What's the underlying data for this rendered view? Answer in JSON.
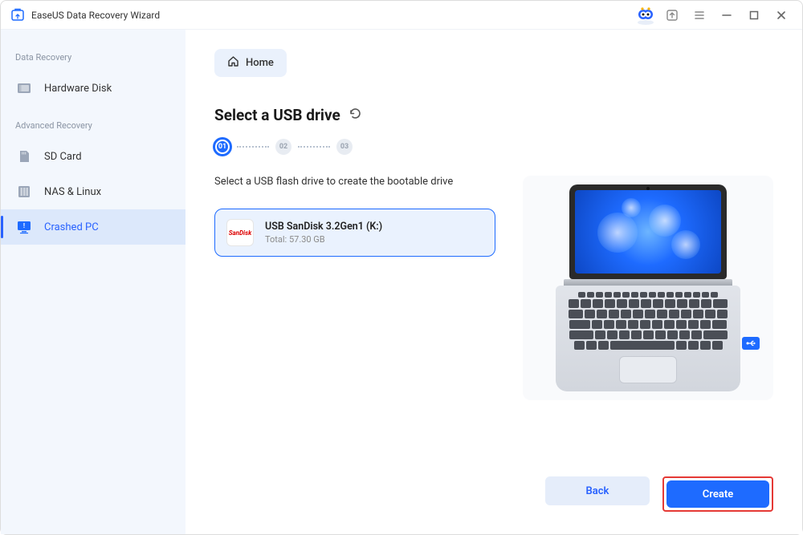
{
  "app": {
    "title": "EaseUS Data Recovery Wizard"
  },
  "sidebar": {
    "section1_title": "Data Recovery",
    "section2_title": "Advanced Recovery",
    "items": {
      "hardware_disk": "Hardware Disk",
      "sd_card": "SD Card",
      "nas_linux": "NAS & Linux",
      "crashed_pc": "Crashed PC"
    }
  },
  "main": {
    "home_label": "Home",
    "heading": "Select a USB drive",
    "steps": {
      "s1": "01",
      "s2": "02",
      "s3": "03"
    },
    "instruction": "Select a USB flash drive to create the bootable drive",
    "drive": {
      "badge": "SanDisk",
      "name": "USB SanDisk 3.2Gen1 (K:)",
      "subtitle": "Total: 57.30 GB"
    },
    "buttons": {
      "back": "Back",
      "create": "Create"
    }
  }
}
